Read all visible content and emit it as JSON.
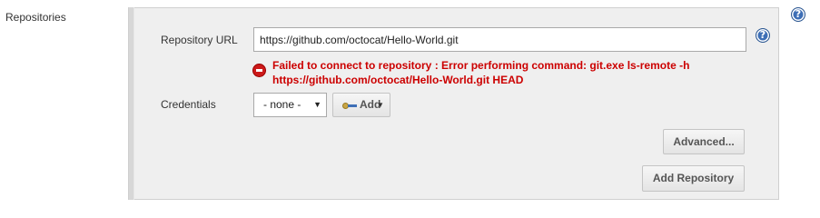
{
  "section": {
    "label": "Repositories"
  },
  "help": {
    "glyph": "?"
  },
  "repository_url": {
    "label": "Repository URL",
    "value": "https://github.com/octocat/Hello-World.git"
  },
  "error": {
    "line1": "Failed to connect to repository : Error performing command: git.exe ls-remote -h",
    "line2": "https://github.com/octocat/Hello-World.git HEAD"
  },
  "credentials": {
    "label": "Credentials",
    "selected": "- none -",
    "caret": "▼",
    "add_label": "Add",
    "add_caret": "▼"
  },
  "buttons": {
    "advanced": "Advanced...",
    "add_repository": "Add Repository"
  },
  "colors": {
    "error": "#cc0000",
    "panel_bg": "#efefef",
    "help_blue": "#3e6fb6"
  }
}
